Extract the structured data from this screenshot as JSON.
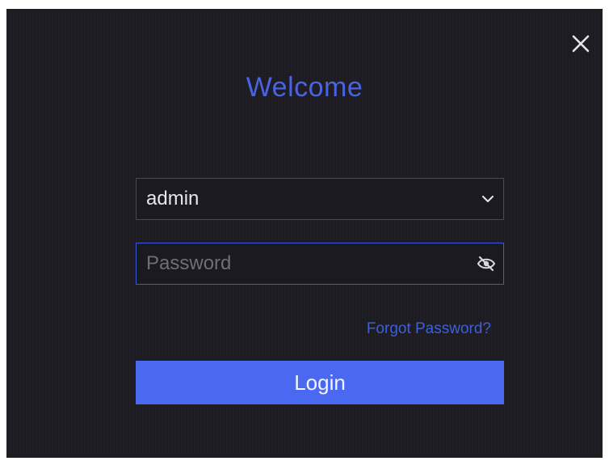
{
  "dialog": {
    "title": "Welcome",
    "close_icon": "close-icon"
  },
  "username": {
    "value": "admin",
    "icon": "chevron-down-icon"
  },
  "password": {
    "placeholder": "Password",
    "value": "",
    "icon": "eye-slash-icon"
  },
  "links": {
    "forgot_password": "Forgot Password?"
  },
  "buttons": {
    "login": "Login"
  },
  "colors": {
    "background": "#1c1c22",
    "accent": "#4a68f0",
    "title": "#4a63e0",
    "link": "#3f5fd8"
  }
}
